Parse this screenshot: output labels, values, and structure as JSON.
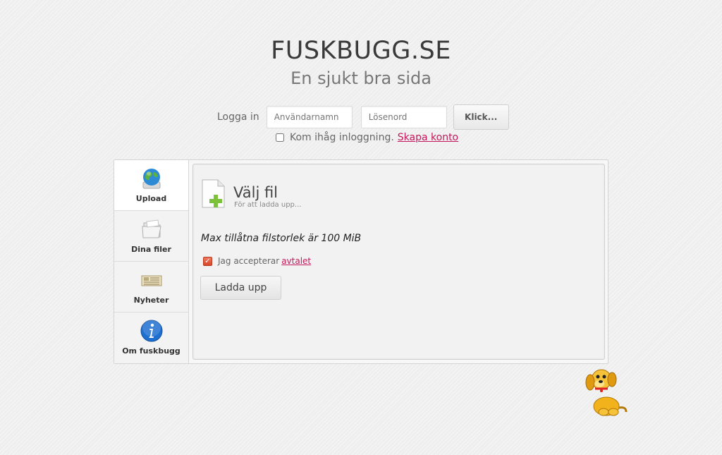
{
  "header": {
    "title": "FUSKBUGG.SE",
    "subtitle": "En sjukt bra sida"
  },
  "login": {
    "label": "Logga in",
    "username_placeholder": "Användarnamn",
    "password_placeholder": "Lösenord",
    "button_label": "Klick...",
    "remember_label": "Kom ihåg inloggning.",
    "create_account_link": "Skapa konto"
  },
  "sidebar": {
    "items": [
      {
        "label": "Upload",
        "icon": "globe-drive-icon",
        "active": true
      },
      {
        "label": "Dina filer",
        "icon": "folder-icon",
        "active": false
      },
      {
        "label": "Nyheter",
        "icon": "newspaper-icon",
        "active": false
      },
      {
        "label": "Om fuskbugg",
        "icon": "info-icon",
        "active": false
      }
    ]
  },
  "upload": {
    "title": "Välj fil",
    "subtitle": "För att ladda upp...",
    "max_size_text": "Max tillåtna filstorlek är 100 MiB",
    "accept_label": "Jag accepterar",
    "accept_link": "avtalet",
    "accept_checked": true,
    "button_label": "Ladda upp"
  },
  "colors": {
    "link": "#c2185b",
    "accent_green": "#7cc13a",
    "info_blue": "#1e6fd0"
  }
}
